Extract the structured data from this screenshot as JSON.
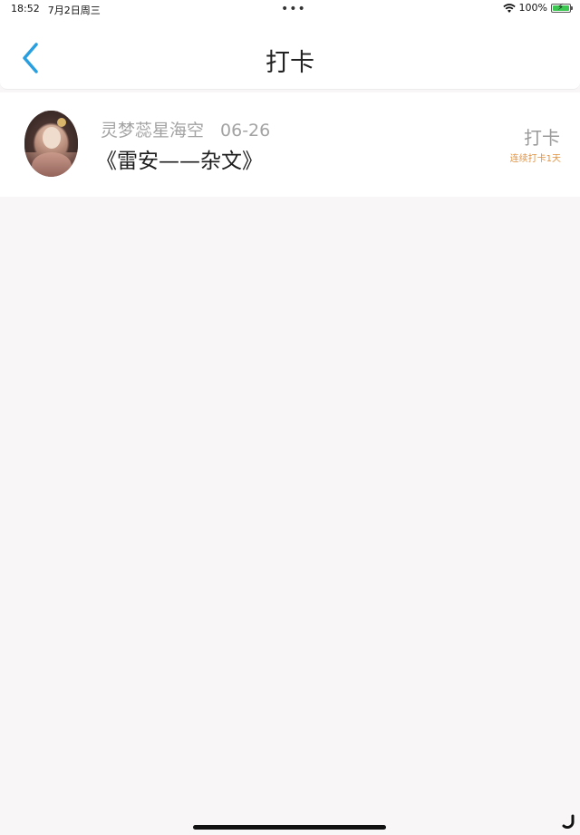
{
  "status_bar": {
    "time": "18:52",
    "date": "7月2日周三",
    "dots": "•••",
    "battery": "100%",
    "icons": [
      "wifi-icon",
      "battery-charging-icon"
    ],
    "battery_color": "#3cc752"
  },
  "nav": {
    "title": "打卡",
    "back_icon": "chevron-left-icon",
    "accent_color": "#2a9fe0"
  },
  "checkin_list": [
    {
      "author": "灵梦蕊星海空",
      "date": "06-26",
      "title": "《雷安——杂文》",
      "action_label": "打卡",
      "streak": "连续打卡1天",
      "streak_color": "#e29240"
    }
  ]
}
